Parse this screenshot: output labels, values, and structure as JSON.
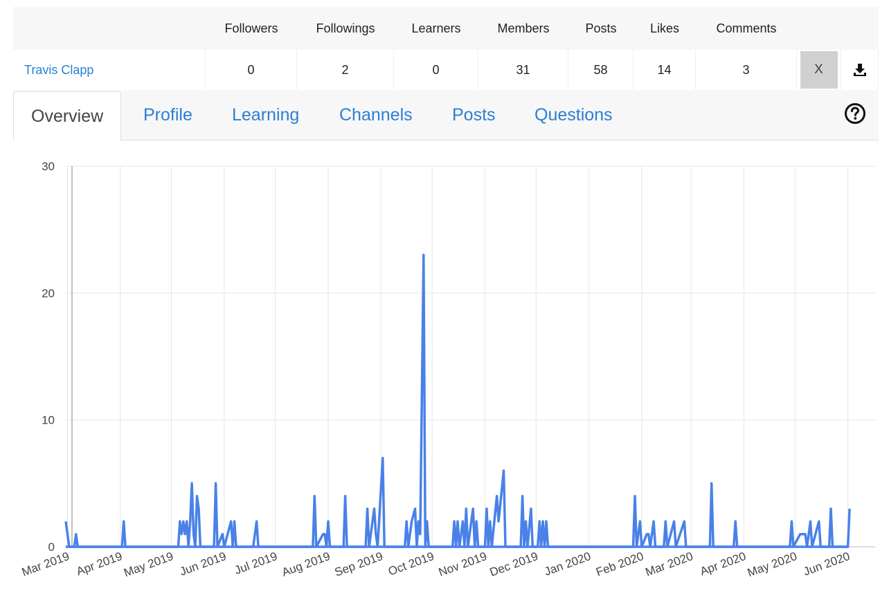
{
  "stats": {
    "headers": [
      "Followers",
      "Followings",
      "Learners",
      "Members",
      "Posts",
      "Likes",
      "Comments"
    ],
    "user_name": "Travis Clapp",
    "values": [
      "0",
      "2",
      "0",
      "31",
      "58",
      "14",
      "3"
    ],
    "close_label": "X",
    "download_icon": "download-icon"
  },
  "tabs": [
    {
      "label": "Overview",
      "active": true
    },
    {
      "label": "Profile",
      "active": false
    },
    {
      "label": "Learning",
      "active": false
    },
    {
      "label": "Channels",
      "active": false
    },
    {
      "label": "Posts",
      "active": false
    },
    {
      "label": "Questions",
      "active": false
    }
  ],
  "help_icon": "help-circle-icon",
  "colors": {
    "line": "#4a81e8",
    "link": "#2a7fd4",
    "grid": "#e6e6e6"
  },
  "chart_data": {
    "type": "line",
    "ylim": [
      0,
      30
    ],
    "yticks": [
      0,
      10,
      20,
      30
    ],
    "grid": true,
    "x_tick_labels": [
      "Mar 2019",
      "Apr 2019",
      "May 2019",
      "Jun 2019",
      "Jul 2019",
      "Aug 2019",
      "Sep 2019",
      "Oct 2019",
      "Nov 2019",
      "Dec 2019",
      "Jan 2020",
      "Feb 2020",
      "Mar 2020",
      "Apr 2020",
      "May 2020",
      "Jun 2020"
    ],
    "x_range": [
      "2019-02-28",
      "2020-06-17"
    ],
    "series": [
      {
        "values": [
          [
            "2019-02-28",
            2
          ],
          [
            "2019-03-01",
            1
          ],
          [
            "2019-03-02",
            0
          ],
          [
            "2019-03-05",
            0
          ],
          [
            "2019-03-06",
            1
          ],
          [
            "2019-03-07",
            0
          ],
          [
            "2019-04-02",
            0
          ],
          [
            "2019-04-03",
            2
          ],
          [
            "2019-04-04",
            0
          ],
          [
            "2019-05-05",
            0
          ],
          [
            "2019-05-06",
            2
          ],
          [
            "2019-05-07",
            1
          ],
          [
            "2019-05-08",
            2
          ],
          [
            "2019-05-09",
            1
          ],
          [
            "2019-05-10",
            2
          ],
          [
            "2019-05-11",
            0
          ],
          [
            "2019-05-12",
            2
          ],
          [
            "2019-05-13",
            5
          ],
          [
            "2019-05-14",
            1
          ],
          [
            "2019-05-15",
            0
          ],
          [
            "2019-05-16",
            4
          ],
          [
            "2019-05-17",
            3
          ],
          [
            "2019-05-18",
            0
          ],
          [
            "2019-05-26",
            0
          ],
          [
            "2019-05-27",
            5
          ],
          [
            "2019-05-28",
            0
          ],
          [
            "2019-05-31",
            1
          ],
          [
            "2019-06-01",
            0
          ],
          [
            "2019-06-05",
            2
          ],
          [
            "2019-06-06",
            0
          ],
          [
            "2019-06-07",
            2
          ],
          [
            "2019-06-08",
            0
          ],
          [
            "2019-06-18",
            0
          ],
          [
            "2019-06-19",
            1
          ],
          [
            "2019-06-20",
            2
          ],
          [
            "2019-06-21",
            0
          ],
          [
            "2019-07-23",
            0
          ],
          [
            "2019-07-24",
            4
          ],
          [
            "2019-07-25",
            0
          ],
          [
            "2019-07-29",
            1
          ],
          [
            "2019-07-30",
            1
          ],
          [
            "2019-07-31",
            0
          ],
          [
            "2019-08-01",
            2
          ],
          [
            "2019-08-02",
            0
          ],
          [
            "2019-08-10",
            0
          ],
          [
            "2019-08-11",
            4
          ],
          [
            "2019-08-12",
            0
          ],
          [
            "2019-08-23",
            0
          ],
          [
            "2019-08-24",
            3
          ],
          [
            "2019-08-25",
            0
          ],
          [
            "2019-08-28",
            3
          ],
          [
            "2019-08-29",
            1
          ],
          [
            "2019-08-30",
            0
          ],
          [
            "2019-09-02",
            7
          ],
          [
            "2019-09-03",
            0
          ],
          [
            "2019-09-15",
            0
          ],
          [
            "2019-09-16",
            2
          ],
          [
            "2019-09-17",
            0
          ],
          [
            "2019-09-19",
            2
          ],
          [
            "2019-09-21",
            3
          ],
          [
            "2019-09-22",
            0
          ],
          [
            "2019-09-23",
            2
          ],
          [
            "2019-09-24",
            1
          ],
          [
            "2019-09-26",
            23
          ],
          [
            "2019-09-27",
            0
          ],
          [
            "2019-09-28",
            2
          ],
          [
            "2019-09-29",
            0
          ],
          [
            "2019-10-13",
            0
          ],
          [
            "2019-10-14",
            2
          ],
          [
            "2019-10-15",
            0
          ],
          [
            "2019-10-16",
            2
          ],
          [
            "2019-10-17",
            0
          ],
          [
            "2019-10-18",
            1
          ],
          [
            "2019-10-19",
            2
          ],
          [
            "2019-10-20",
            0
          ],
          [
            "2019-10-21",
            3
          ],
          [
            "2019-10-22",
            0
          ],
          [
            "2019-10-25",
            3
          ],
          [
            "2019-10-26",
            0
          ],
          [
            "2019-10-27",
            2
          ],
          [
            "2019-10-28",
            0
          ],
          [
            "2019-11-01",
            0
          ],
          [
            "2019-11-02",
            3
          ],
          [
            "2019-11-03",
            0
          ],
          [
            "2019-11-04",
            2
          ],
          [
            "2019-11-05",
            0
          ],
          [
            "2019-11-08",
            4
          ],
          [
            "2019-11-09",
            2
          ],
          [
            "2019-11-12",
            6
          ],
          [
            "2019-11-13",
            0
          ],
          [
            "2019-11-22",
            0
          ],
          [
            "2019-11-23",
            4
          ],
          [
            "2019-11-24",
            0
          ],
          [
            "2019-11-25",
            2
          ],
          [
            "2019-11-26",
            0
          ],
          [
            "2019-11-28",
            3
          ],
          [
            "2019-11-29",
            0
          ],
          [
            "2019-12-02",
            0
          ],
          [
            "2019-12-03",
            2
          ],
          [
            "2019-12-04",
            0
          ],
          [
            "2019-12-05",
            2
          ],
          [
            "2019-12-06",
            0
          ],
          [
            "2019-12-07",
            2
          ],
          [
            "2019-12-08",
            0
          ],
          [
            "2020-01-27",
            0
          ],
          [
            "2020-01-28",
            4
          ],
          [
            "2020-01-29",
            0
          ],
          [
            "2020-01-31",
            2
          ],
          [
            "2020-02-01",
            0
          ],
          [
            "2020-02-04",
            1
          ],
          [
            "2020-02-05",
            1
          ],
          [
            "2020-02-06",
            0
          ],
          [
            "2020-02-08",
            2
          ],
          [
            "2020-02-09",
            0
          ],
          [
            "2020-02-14",
            0
          ],
          [
            "2020-02-15",
            2
          ],
          [
            "2020-02-16",
            0
          ],
          [
            "2020-02-20",
            2
          ],
          [
            "2020-02-21",
            0
          ],
          [
            "2020-02-26",
            2
          ],
          [
            "2020-02-27",
            0
          ],
          [
            "2020-03-12",
            0
          ],
          [
            "2020-03-13",
            5
          ],
          [
            "2020-03-14",
            0
          ],
          [
            "2020-03-26",
            0
          ],
          [
            "2020-03-27",
            2
          ],
          [
            "2020-03-28",
            0
          ],
          [
            "2020-04-28",
            0
          ],
          [
            "2020-04-29",
            2
          ],
          [
            "2020-04-30",
            0
          ],
          [
            "2020-05-04",
            1
          ],
          [
            "2020-05-07",
            1
          ],
          [
            "2020-05-08",
            0
          ],
          [
            "2020-05-10",
            2
          ],
          [
            "2020-05-11",
            0
          ],
          [
            "2020-05-15",
            2
          ],
          [
            "2020-05-16",
            0
          ],
          [
            "2020-05-21",
            0
          ],
          [
            "2020-05-22",
            3
          ],
          [
            "2020-05-23",
            0
          ],
          [
            "2020-06-01",
            0
          ],
          [
            "2020-06-02",
            3
          ]
        ]
      }
    ]
  }
}
